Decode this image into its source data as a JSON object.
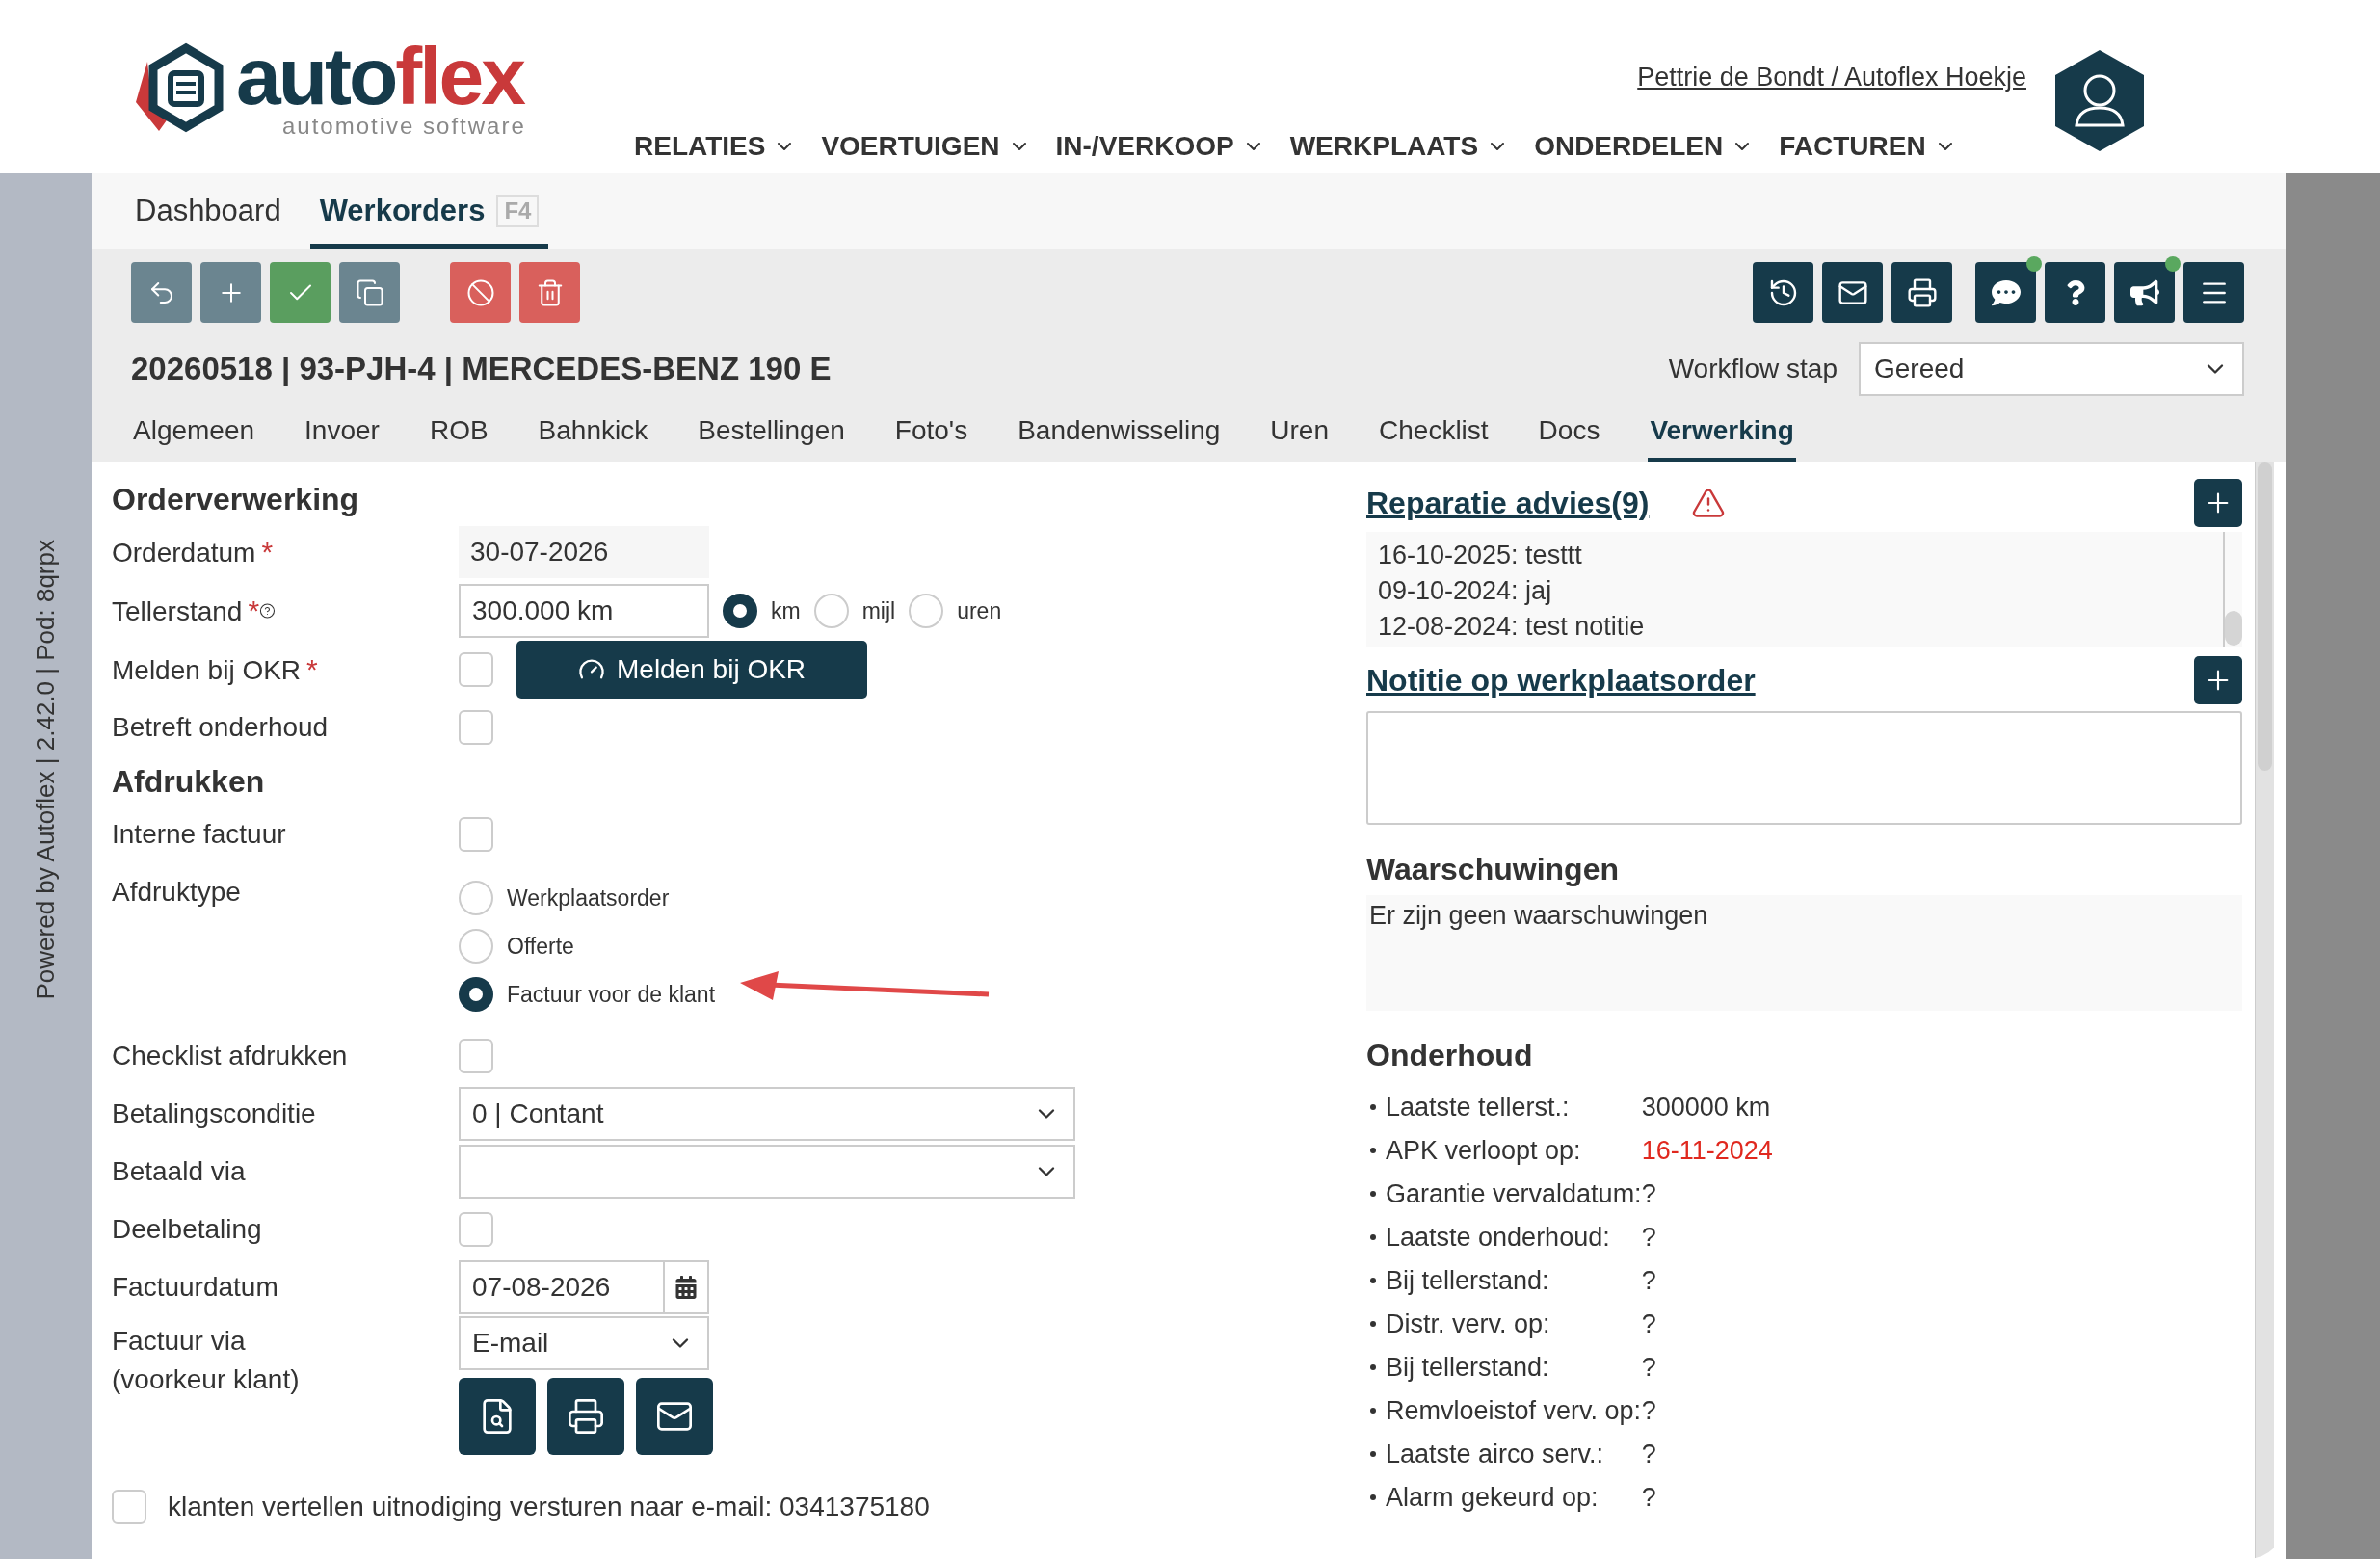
{
  "header": {
    "logo": {
      "wordmark": [
        "auto",
        "flex"
      ],
      "tagline": "automotive software"
    },
    "user_link": "Pettrie de Bondt / Autoflex Hoekje",
    "nav": [
      "RELATIES",
      "VOERTUIGEN",
      "IN-/VERKOOP",
      "WERKPLAATS",
      "ONDERDELEN",
      "FACTUREN"
    ]
  },
  "side_label": "Powered by Autoflex | 2.42.0 | Pod: 8qrpx",
  "page_tabs": [
    {
      "label": "Dashboard",
      "selected": false
    },
    {
      "label": "Werkorders",
      "shortcut": "F4",
      "selected": true
    }
  ],
  "toolbar": {
    "right_buttons": [
      {
        "notification": false
      },
      {
        "notification": false
      },
      {
        "notification": false
      },
      {
        "notification": true
      },
      {
        "notification": false
      },
      {
        "notification": true
      }
    ]
  },
  "title": "20260518 | 93-PJH-4 | MERCEDES-BENZ 190 E",
  "workflow": {
    "label": "Workflow stap",
    "value": "Gereed"
  },
  "tabs": [
    {
      "label": "Algemeen",
      "selected": false
    },
    {
      "label": "Invoer",
      "selected": false
    },
    {
      "label": "ROB",
      "selected": false
    },
    {
      "label": "Bahnkick",
      "selected": false
    },
    {
      "label": "Bestellingen",
      "selected": false
    },
    {
      "label": "Foto's",
      "selected": false
    },
    {
      "label": "Bandenwisseling",
      "selected": false
    },
    {
      "label": "Uren",
      "selected": false
    },
    {
      "label": "Checklist",
      "selected": false
    },
    {
      "label": "Docs",
      "selected": false
    },
    {
      "label": "Verwerking",
      "selected": true
    }
  ],
  "form": [
    {
      "kind": "heading",
      "label": "Orderverwerking"
    },
    {
      "kind": "readonly",
      "label": "Orderdatum",
      "required_mark": "*",
      "value": "30-07-2026"
    },
    {
      "kind": "odometer",
      "label": "Tellerstand",
      "required_mark": "*",
      "value": "300.000 km",
      "units": [
        {
          "label": "km",
          "selected": true
        },
        {
          "label": "mijl",
          "selected": false
        },
        {
          "label": "uren",
          "selected": false
        }
      ]
    },
    {
      "kind": "checkbox",
      "label": "Melden bij OKR",
      "required_mark": "*",
      "checked": false,
      "button": "Melden bij OKR"
    },
    {
      "kind": "checkbox",
      "label": "Betreft onderhoud",
      "checked": false
    },
    {
      "kind": "heading",
      "label": "Afdrukken"
    },
    {
      "kind": "checkbox",
      "label": "Interne factuur",
      "checked": false
    },
    {
      "kind": "radios",
      "label": "Afdruktype",
      "options": [
        {
          "label": "Werkplaatsorder",
          "selected": false
        },
        {
          "label": "Offerte",
          "selected": false
        },
        {
          "label": "Factuur voor de klant",
          "selected": true
        }
      ]
    },
    {
      "kind": "checkbox",
      "label": "Checklist afdrukken",
      "checked": false
    },
    {
      "kind": "select",
      "label": "Betalingsconditie",
      "value": "0 | Contant"
    },
    {
      "kind": "select",
      "label": "Betaald via"
    },
    {
      "kind": "checkbox",
      "label": "Deelbetaling",
      "checked": false
    },
    {
      "kind": "date",
      "label": "Factuurdatum",
      "value": "07-08-2026"
    },
    {
      "kind": "send",
      "label": "Factuur via",
      "sublabel": "(voorkeur klant)",
      "value": "E-mail"
    }
  ],
  "invite": {
    "checked": false,
    "text": "klanten vertellen uitnodiging versturen naar e-mail: 0341375180"
  },
  "repair": {
    "title": "Reparatie advies(9)",
    "warning": true,
    "items": [
      "16-10-2025: testtt",
      "09-10-2024: jaj",
      "12-08-2024: test notitie"
    ]
  },
  "note": {
    "title": "Notitie op werkplaatsorder"
  },
  "warnings": {
    "title": "Waarschuwingen",
    "text": "Er zijn geen waarschuwingen"
  },
  "maintenance": {
    "title": "Onderhoud",
    "items": [
      {
        "label": "Laatste tellerst.:",
        "value": "300000 km",
        "overdue": false
      },
      {
        "label": "APK verloopt op:",
        "value": "16-11-2024",
        "overdue": true
      },
      {
        "label": "Garantie vervaldatum:",
        "value": "?",
        "overdue": false
      },
      {
        "label": "Laatste onderhoud:",
        "value": "?",
        "overdue": false
      },
      {
        "label": "Bij tellerstand:",
        "value": "?",
        "overdue": false
      },
      {
        "label": "Distr. verv. op:",
        "value": "?",
        "overdue": false
      },
      {
        "label": "Bij tellerstand:",
        "value": "?",
        "overdue": false
      },
      {
        "label": "Remvloeistof verv. op:",
        "value": "?",
        "overdue": false
      },
      {
        "label": "Laatste airco serv.:",
        "value": "?",
        "overdue": false
      },
      {
        "label": "Alarm gekeurd op:",
        "value": "?",
        "overdue": false
      }
    ]
  }
}
